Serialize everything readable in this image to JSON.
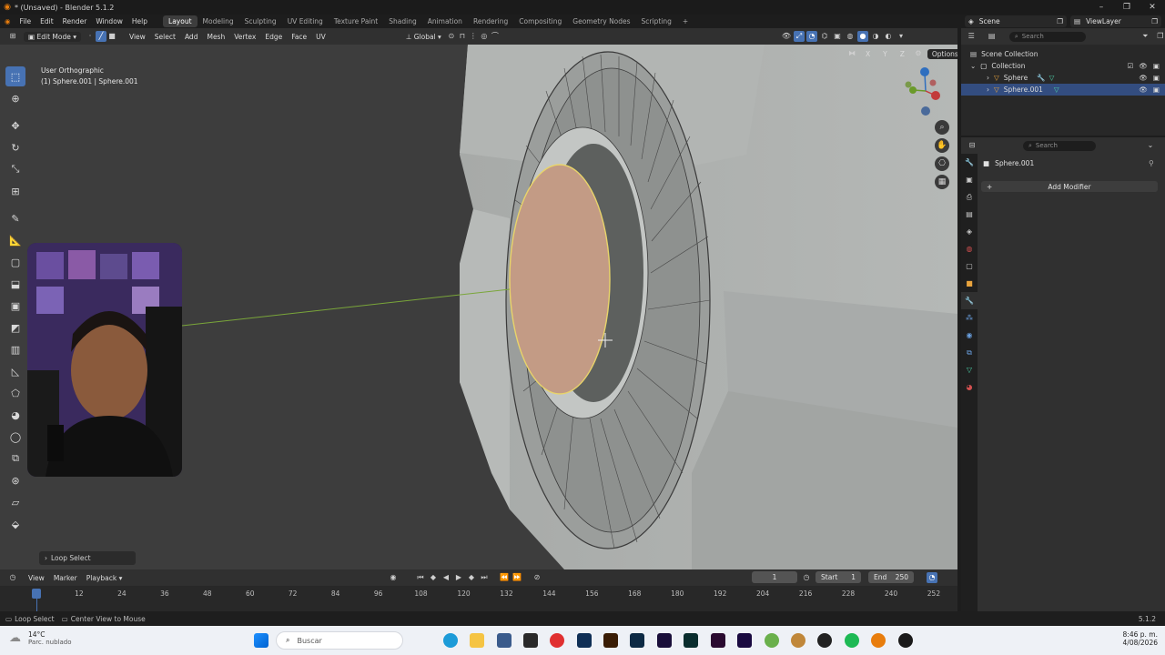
{
  "window": {
    "title": "* (Unsaved) - Blender 5.1.2"
  },
  "menu": [
    "File",
    "Edit",
    "Render",
    "Window",
    "Help"
  ],
  "workspaces": [
    "Layout",
    "Modeling",
    "Sculpting",
    "UV Editing",
    "Texture Paint",
    "Shading",
    "Animation",
    "Rendering",
    "Compositing",
    "Geometry Nodes",
    "Scripting"
  ],
  "active_workspace": "Layout",
  "scene": {
    "name": "Scene",
    "view_layer": "ViewLayer"
  },
  "viewport": {
    "mode": "Edit Mode",
    "menus": [
      "View",
      "Select",
      "Add",
      "Mesh",
      "Vertex",
      "Edge",
      "Face",
      "UV"
    ],
    "transform_orientation": "Global",
    "view_name": "User Orthographic",
    "object_info": "(1) Sphere.001 | Sphere.001",
    "axes": [
      "X",
      "Y",
      "Z"
    ],
    "options_label": "Options",
    "last_operator": "Loop Select"
  },
  "timeline": {
    "menus": [
      "View",
      "Marker",
      "Playback"
    ],
    "current_frame": "1",
    "start_label": "Start",
    "start": "1",
    "end_label": "End",
    "end": "250",
    "ticks": [
      "1",
      "12",
      "24",
      "36",
      "48",
      "60",
      "72",
      "84",
      "96",
      "108",
      "120",
      "132",
      "144",
      "156",
      "168",
      "180",
      "192",
      "204",
      "216",
      "228",
      "240",
      "252"
    ]
  },
  "outliner": {
    "search_placeholder": "Search",
    "root": "Scene Collection",
    "collection": "Collection",
    "items": [
      "Sphere",
      "Sphere.001"
    ],
    "selected": "Sphere.001"
  },
  "properties": {
    "search_placeholder": "Search",
    "object_name": "Sphere.001",
    "add_modifier": "Add Modifier"
  },
  "statusbar": {
    "left_action": "Loop Select",
    "mid_action": "Center View to Mouse",
    "version": "5.1.2"
  },
  "taskbar": {
    "weather_temp": "14°C",
    "weather_desc": "Parc. nublado",
    "search_placeholder": "Buscar",
    "time": "8:46 p. m.",
    "date": "4/08/2026"
  },
  "colors": {
    "accent": "#4772b3",
    "selected_face": "#c39b85",
    "selection_edge": "#e8d46a",
    "viewport_bg": "#3d3d3d"
  }
}
